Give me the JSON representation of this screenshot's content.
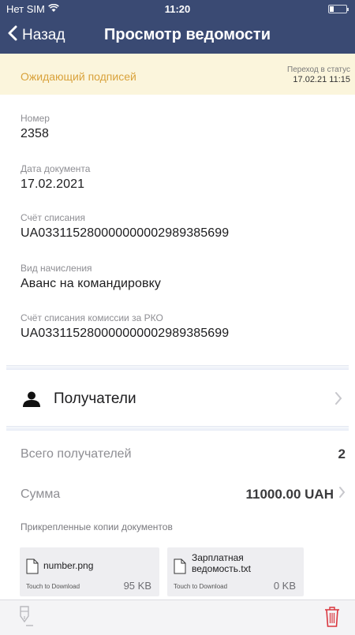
{
  "statusbar": {
    "carrier": "Нет SIM",
    "time": "11:20"
  },
  "navbar": {
    "back_label": "Назад",
    "title": "Просмотр ведомости"
  },
  "status": {
    "text": "Ожидающий подписей",
    "transition_label": "Переход в статус",
    "transition_datetime": "17.02.21 11:15"
  },
  "fields": {
    "number": {
      "label": "Номер",
      "value": "2358"
    },
    "doc_date": {
      "label": "Дата документа",
      "value": "17.02.2021"
    },
    "debit_account": {
      "label": "Счёт списания",
      "value": "UA033115280000000002989385699"
    },
    "accrual_type": {
      "label": "Вид начисления",
      "value": "Аванс на командировку"
    },
    "commission_account": {
      "label": "Счёт списания комиссии за РКО",
      "value": "UA033115280000000002989385699"
    }
  },
  "recipients": {
    "label": "Получатели"
  },
  "summary": {
    "total_label": "Всего получателей",
    "total_value": "2",
    "sum_label": "Сумма",
    "sum_value": "11000.00 UAH"
  },
  "attachments": {
    "title": "Прикрепленные копии документов",
    "files": [
      {
        "name_line1": "number.png",
        "name_line2": "",
        "touch": "Touch to Download",
        "size": "95 KB"
      },
      {
        "name_line1": "Зарплатная",
        "name_line2": "ведомость.txt",
        "touch": "Touch to Download",
        "size": "0 KB"
      }
    ]
  },
  "colors": {
    "header_bg": "#3a4a73",
    "status_bg": "#fbf5dc",
    "status_text": "#d9a23b",
    "trash_icon": "#d9363e"
  },
  "icons": [
    "wifi-icon",
    "battery-icon",
    "back-chevron-icon",
    "person-icon",
    "chevron-right-icon",
    "document-icon",
    "sign-pen-icon",
    "trash-icon"
  ]
}
